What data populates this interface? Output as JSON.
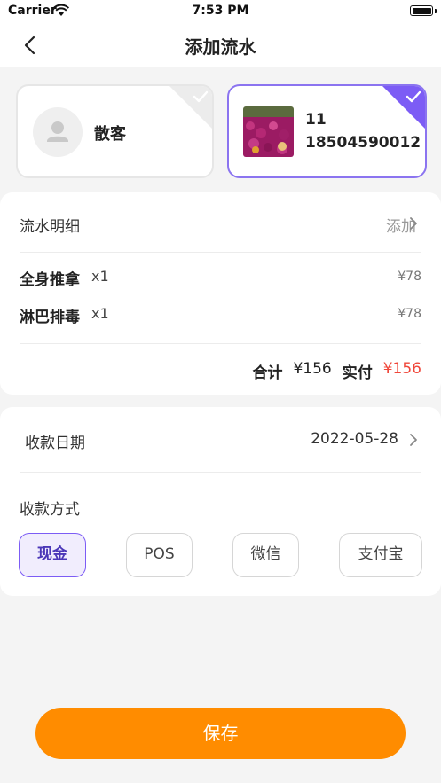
{
  "status_bar": {
    "carrier": "Carrier",
    "time": "7:53 PM"
  },
  "nav": {
    "title": "添加流水"
  },
  "customers": {
    "guest": {
      "name": "散客"
    },
    "member": {
      "id": "11",
      "phone": "18504590012"
    }
  },
  "flow": {
    "header": "流水明细",
    "add_label": "添加",
    "items": [
      {
        "name": "全身推拿",
        "qty": "x1",
        "price": "¥78"
      },
      {
        "name": "淋巴排毒",
        "qty": "x1",
        "price": "¥78"
      }
    ],
    "total_label": "合计",
    "total_value": "¥156",
    "actual_label": "实付",
    "actual_value": "¥156"
  },
  "payment": {
    "date_label": "收款日期",
    "date_value": "2022-05-28",
    "method_label": "收款方式",
    "methods": [
      "现金",
      "POS",
      "微信",
      "支付宝"
    ],
    "selected": "现金"
  },
  "save_label": "保存",
  "colors": {
    "accent": "#7c5cf5",
    "primary": "#ff8c00",
    "price_red": "#f0473a"
  }
}
